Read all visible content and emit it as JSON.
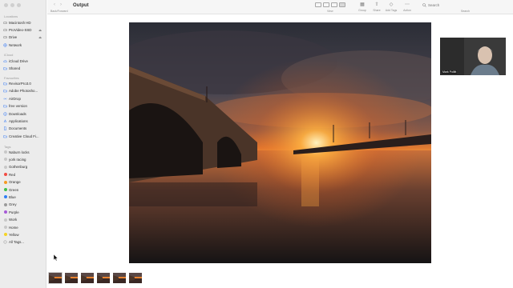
{
  "window": {
    "title": "Output",
    "nav_caption": "Back/Forward"
  },
  "toolbar": {
    "view_label": "View",
    "group_label": "Group",
    "share_label": "Share",
    "add_tags_label": "Add Tags",
    "action_label": "Action",
    "search_placeholder": "Search",
    "search_label": "Search"
  },
  "sidebar": {
    "locations_header": "Locations",
    "locations": [
      {
        "label": "Macintosh HD",
        "icon": "drive-icon"
      },
      {
        "label": "ProVideo-SSD",
        "icon": "drive-icon",
        "eject": "⏏"
      },
      {
        "label": "Drive",
        "icon": "drive-icon",
        "eject": "⏏"
      },
      {
        "label": "Network",
        "icon": "network-icon"
      }
    ],
    "icloud_header": "iCloud",
    "icloud": [
      {
        "label": "iCloud Drive",
        "icon": "cloud-icon"
      },
      {
        "label": "Shared",
        "icon": "shared-folder-icon"
      }
    ],
    "favourites_header": "Favourites",
    "favourites": [
      {
        "label": "RevisorPro3.0",
        "icon": "folder-icon"
      },
      {
        "label": "Adobe Photosho...",
        "icon": "folder-icon"
      },
      {
        "label": "AirDrop",
        "icon": "airdrop-icon"
      },
      {
        "label": "free version",
        "icon": "folder-icon"
      },
      {
        "label": "Downloads",
        "icon": "downloads-icon"
      },
      {
        "label": "Applications",
        "icon": "applications-icon"
      },
      {
        "label": "Documents",
        "icon": "documents-icon"
      },
      {
        "label": "Creative Cloud Fi...",
        "icon": "creative-cloud-icon"
      }
    ],
    "tags_header": "Tags",
    "tags": [
      {
        "label": "Naburn locks",
        "color": "#c8c8c8"
      },
      {
        "label": "york racing",
        "color": "#c8c8c8"
      },
      {
        "label": "Gothenburg",
        "color": "#c8c8c8"
      },
      {
        "label": "Red",
        "color": "#f24b43"
      },
      {
        "label": "Orange",
        "color": "#f59a23"
      },
      {
        "label": "Green",
        "color": "#3fbf4b"
      },
      {
        "label": "Blue",
        "color": "#2f7ef5"
      },
      {
        "label": "Grey",
        "color": "#9a9a9a"
      },
      {
        "label": "Purple",
        "color": "#a65ad6"
      },
      {
        "label": "Work",
        "color": "#c8c8c8"
      },
      {
        "label": "Home",
        "color": "#c8c8c8"
      },
      {
        "label": "Yellow",
        "color": "#f5d323"
      },
      {
        "label": "All Tags...",
        "color": "all-tags-icon"
      }
    ]
  },
  "webcam": {
    "name": "Mark Pollitt"
  },
  "thumbnails": {
    "count": 6,
    "selected_index": 0
  },
  "colors": {
    "sidebar_bg": "#ececec",
    "toolbar_bg": "#f6f6f6",
    "sunset_orange": "#f28a2a"
  }
}
